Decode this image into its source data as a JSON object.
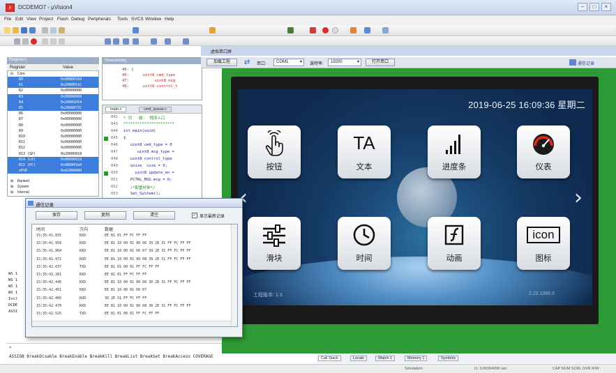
{
  "window": {
    "title": "DCDEMO7 - µVision4"
  },
  "menu": [
    "File",
    "Edit",
    "View",
    "Project",
    "Flash",
    "Debug",
    "Peripherals",
    "Tools",
    "SVCS",
    "Window",
    "Help"
  ],
  "registers": {
    "header": "Registers",
    "cols": [
      "Register",
      "Value"
    ],
    "group_core": "Core",
    "rows": [
      {
        "name": "R0",
        "value": "0x0800016d",
        "sel": true
      },
      {
        "name": "R1",
        "value": "0x2000051C",
        "sel": true
      },
      {
        "name": "R2",
        "value": "0x00000000",
        "sel": false
      },
      {
        "name": "R3",
        "value": "0x00000000",
        "sel": true
      },
      {
        "name": "R4",
        "value": "0x20001D54",
        "sel": true
      },
      {
        "name": "R5",
        "value": "0x2000072C",
        "sel": true
      },
      {
        "name": "R6",
        "value": "0x00000000",
        "sel": false
      },
      {
        "name": "R7",
        "value": "0x00000000",
        "sel": false
      },
      {
        "name": "R8",
        "value": "0x00000000",
        "sel": false
      },
      {
        "name": "R9",
        "value": "0x00000000",
        "sel": false
      },
      {
        "name": "R10",
        "value": "0x00000000",
        "sel": false
      },
      {
        "name": "R11",
        "value": "0x00000000",
        "sel": false
      },
      {
        "name": "R12",
        "value": "0x00000000",
        "sel": false
      },
      {
        "name": "R13 (SP)",
        "value": "0x20000818",
        "sel": false
      },
      {
        "name": "R14 (LR)",
        "value": "0x08000018",
        "sel": true
      },
      {
        "name": "R15 (PC)",
        "value": "0x080003a4",
        "sel": true
      },
      {
        "name": "xPSR",
        "value": "0xA1000000",
        "sel": true
      }
    ],
    "group_banked": "Banked",
    "group_system": "System",
    "group_internal": "Internal"
  },
  "disasm": {
    "header": "Disassembly",
    "lines": [
      "45: {",
      "46:      uint8 cmd_type",
      "47:           uint8 msg",
      "48:      uint8 control_t"
    ]
  },
  "editor": {
    "tabs": [
      "main.c",
      "cmd_queue.c"
    ],
    "lines": [
      {
        "n": "042",
        "t": "* 功   能:  程序入口"
      },
      {
        "n": "043",
        "t": "**********************"
      },
      {
        "n": "044",
        "t": "int main(void)"
      },
      {
        "n": "045",
        "t": "{"
      },
      {
        "n": "046",
        "t": "   uint8 cmd_type = 0"
      },
      {
        "n": "047",
        "t": "      uint8 msg_type ="
      },
      {
        "n": "048",
        "t": "   uint8 control_type"
      },
      {
        "n": "049",
        "t": "   qsize  size = 0;"
      },
      {
        "n": "050",
        "t": "     uint8 update_en ="
      },
      {
        "n": "051",
        "t": "   PCTRL_MSG msg = 0;"
      },
      {
        "n": "052",
        "t": "   /*配置时钟*/"
      },
      {
        "n": "053",
        "t": "   Set_System();"
      }
    ]
  },
  "output_lines": [
    "WS 1",
    "WS 1",
    "WS 1",
    "WS 1",
    "Incl",
    "DCDE",
    "ASSI"
  ],
  "command_line": "ASSIGN BreakDisable BreakEnable BreakKill BreakList BreakSet BreakAccess COVERAGE",
  "bottom_tabs": [
    "Call Stack",
    "Locals",
    "Watch 1",
    "Memory 1",
    "Symbols"
  ],
  "status": {
    "mode": "Simulation",
    "time": "t1: 0.00064000 sec",
    "flags": "CAP  NUM  SCRL  OVR  R/W"
  },
  "serial_tool": {
    "title": "虚拟串口屏",
    "load_btn": "加载工程",
    "port_label": "串口:",
    "port_value": "COM1",
    "baud_label": "波特率:",
    "baud_value": "19200",
    "open_btn": "打开串口",
    "log_btn": "通信记录"
  },
  "device_screen": {
    "clock": "2019-06-25 16:09:36 星期二",
    "footer_left": "工程版本: 1.3",
    "footer_right": "2.22.1086.0",
    "tiles": [
      "按钮",
      "文本",
      "进度条",
      "仪表",
      "滑块",
      "时间",
      "动画",
      "图标"
    ],
    "tile_text_icons": {
      "text": "TA",
      "icon": "icon"
    }
  },
  "log_dialog": {
    "title": "通信记录",
    "buttons": [
      "保存",
      "复制",
      "清空"
    ],
    "checkbox": "显示最新记录",
    "cols": [
      "时间",
      "方向",
      "数据"
    ],
    "rows": [
      [
        "15:35:41.835",
        "RXD",
        "EE B1 01 FF FC FF FF"
      ],
      [
        "15:35:41.956",
        "RXD",
        "EE B1 10 00 01 00 06 39 2E 31 FF FC FF FF"
      ],
      [
        "15:35:41.964",
        "RXD",
        "EE B1 10 00 01 00 07 39 2E 31 FF FC FF FF"
      ],
      [
        "15:35:41.972",
        "RXD",
        "EE B1 10 00 01 00 08 39 2E 31 FF FC FF FF"
      ],
      [
        "15:35:42.037",
        "TXD",
        "EE B1 01 00 01 FF FC FF FF"
      ],
      [
        "15:35:42.261",
        "RXD",
        "EE B1 01 FF FC FF FF"
      ],
      [
        "15:35:42.446",
        "RXD",
        "EE B1 10 00 01 00 06 30 2E 31 FF FC FF FF"
      ],
      [
        "15:35:42.451",
        "RXD",
        "EE B1 10 00 01 00 07"
      ],
      [
        "15:35:42.466",
        "RXD",
        "30 2E 31 FF FC FF FF"
      ],
      [
        "15:35:42.470",
        "RXD",
        "EE B1 10 00 01 00 08 30 2E 31 FF FC FF FF"
      ],
      [
        "15:35:42.525",
        "TXD",
        "EE B1 01 00 01 FF FC FF FF"
      ]
    ]
  }
}
